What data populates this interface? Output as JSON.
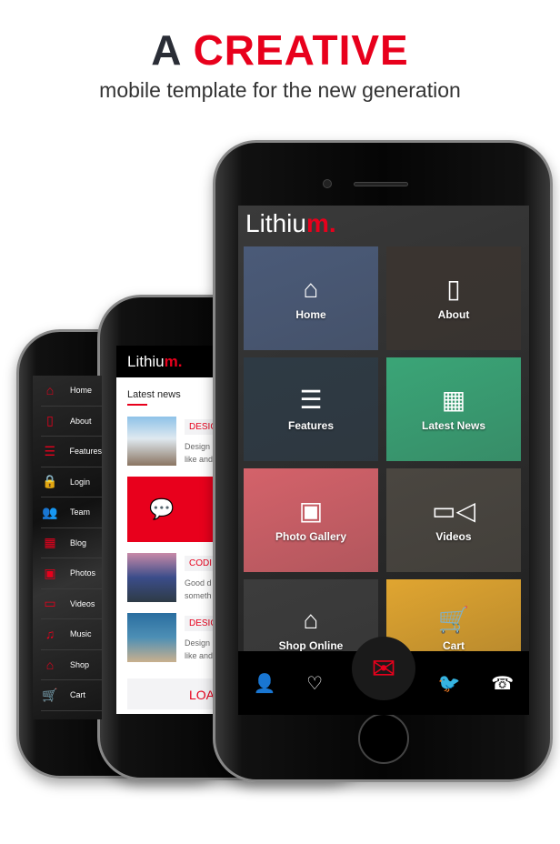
{
  "headline": {
    "prefix": "A",
    "highlight": "CREATIVE",
    "subtitle": "mobile template for the new generation"
  },
  "brand": {
    "name": "Lithiu",
    "accent": "m.",
    "accent_color": "#e8001c"
  },
  "side_menu": [
    {
      "label": "Home",
      "icon": "home-icon",
      "glyph": "⌂"
    },
    {
      "label": "About",
      "icon": "phone-icon",
      "glyph": "▯"
    },
    {
      "label": "Features",
      "icon": "list-icon",
      "glyph": "☰"
    },
    {
      "label": "Login",
      "icon": "lock-icon",
      "glyph": "🔒"
    },
    {
      "label": "Team",
      "icon": "users-icon",
      "glyph": "👥"
    },
    {
      "label": "Blog",
      "icon": "calendar-icon",
      "glyph": "▦"
    },
    {
      "label": "Photos",
      "icon": "image-icon",
      "glyph": "▣"
    },
    {
      "label": "Videos",
      "icon": "video-icon",
      "glyph": "▭"
    },
    {
      "label": "Music",
      "icon": "music-icon",
      "glyph": "♫"
    },
    {
      "label": "Shop",
      "icon": "shop-icon",
      "glyph": "⌂"
    },
    {
      "label": "Cart",
      "icon": "cart-icon",
      "glyph": "🛒"
    }
  ],
  "news": {
    "title": "Latest news",
    "items": [
      {
        "tag": "DESIG",
        "desc1": "Design",
        "desc2": "like and"
      },
      {
        "tag": "CODI",
        "desc1": "Good d",
        "desc2": "someth"
      },
      {
        "tag": "DESIG",
        "desc1": "Design",
        "desc2": "like and"
      }
    ],
    "load_more": "LOA"
  },
  "tiles": [
    {
      "label": "Home",
      "icon": "home-icon",
      "glyph": "⌂",
      "color": "#4a5a78"
    },
    {
      "label": "About",
      "icon": "phone-icon",
      "glyph": "▯",
      "color": "#3a3430"
    },
    {
      "label": "Features",
      "icon": "list-icon",
      "glyph": "☰",
      "color": "#2e3a44"
    },
    {
      "label": "Latest News",
      "icon": "calendar-icon",
      "glyph": "▦",
      "color": "#3aa577"
    },
    {
      "label": "Photo Gallery",
      "icon": "image-icon",
      "glyph": "▣",
      "color": "#d4626a"
    },
    {
      "label": "Videos",
      "icon": "video-icon",
      "glyph": "▭◁",
      "color": "#4a4640"
    },
    {
      "label": "Shop Online",
      "icon": "shop-icon",
      "glyph": "⌂",
      "color": "#3c3c3c"
    },
    {
      "label": "Cart",
      "icon": "cart-icon",
      "glyph": "🛒",
      "color": "#e0a530"
    }
  ],
  "bottom_bar": [
    {
      "icon": "user-icon",
      "glyph": "👤"
    },
    {
      "icon": "heart-icon",
      "glyph": "♡"
    },
    {
      "icon": "mail-icon",
      "glyph": "✉"
    },
    {
      "icon": "twitter-icon",
      "glyph": "🐦"
    },
    {
      "icon": "telephone-icon",
      "glyph": "☎"
    }
  ]
}
